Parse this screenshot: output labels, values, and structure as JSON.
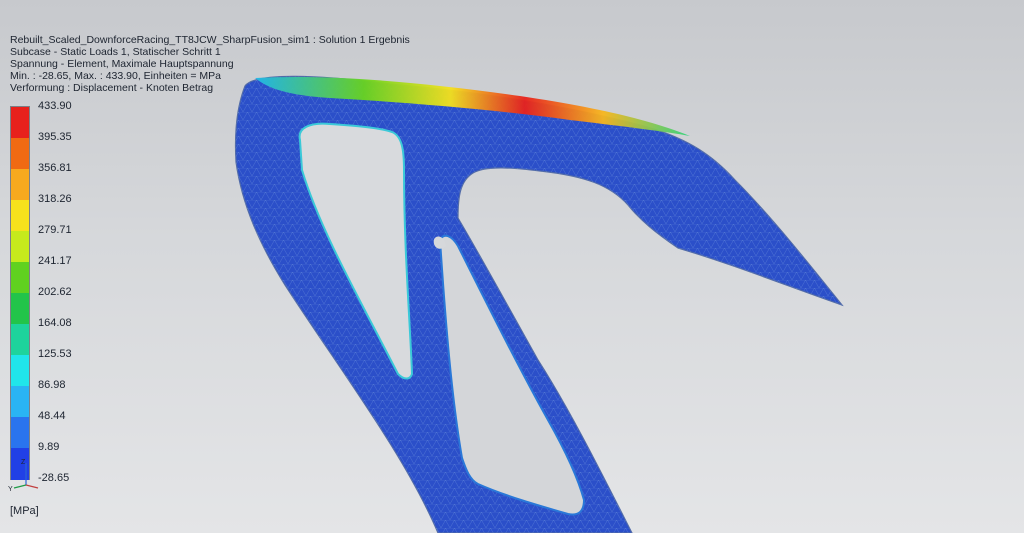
{
  "header": {
    "line1": "Rebuilt_Scaled_DownforceRacing_TT8JCW_SharpFusion_sim1 : Solution 1 Ergebnis",
    "line2": "Subcase - Static Loads 1, Statischer Schritt 1",
    "line3": "Spannung - Element, Maximale Hauptspannung",
    "line4": "Min. : -28.65, Max. : 433.90, Einheiten = MPa",
    "line5": "Verformung : Displacement - Knoten Betrag"
  },
  "legend": {
    "labels": [
      "433.90",
      "395.35",
      "356.81",
      "318.26",
      "279.71",
      "241.17",
      "202.62",
      "164.08",
      "125.53",
      "86.98",
      "48.44",
      "9.89",
      "-28.65"
    ],
    "colors": [
      "#e8211c",
      "#f06a12",
      "#f7a91e",
      "#f6e21c",
      "#c6ea1c",
      "#60d11f",
      "#22c44a",
      "#1ed39c",
      "#20e5ea",
      "#2ab4f3",
      "#2a74ee",
      "#2140e6",
      "#1a1adc"
    ],
    "unit": "[MPa]"
  },
  "triad": {
    "x_label": "Y",
    "z_label": "Z"
  },
  "model": {
    "body_color": "#2a50d0",
    "mesh_color": "#8fb2e8",
    "hot_color": "#e8211c"
  }
}
